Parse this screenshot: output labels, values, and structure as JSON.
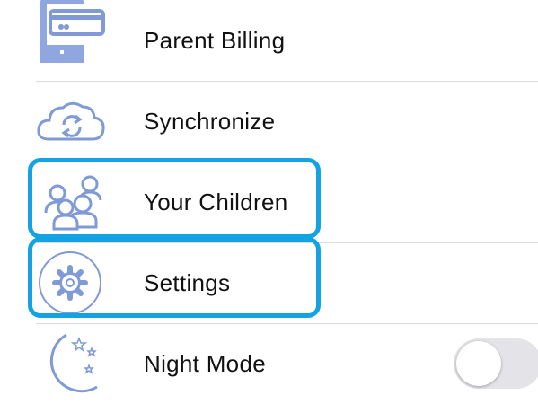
{
  "accent_color": "#13a3e3",
  "icon_color": "#7f9ad6",
  "menu": {
    "items": [
      {
        "label": "Parent Billing",
        "icon": "billing-tablet-icon"
      },
      {
        "label": "Synchronize",
        "icon": "sync-cloud-icon"
      },
      {
        "label": "Your Children",
        "icon": "children-icon",
        "highlighted": true
      },
      {
        "label": "Settings",
        "icon": "gear-icon",
        "highlighted": true
      },
      {
        "label": "Night Mode",
        "icon": "moon-stars-icon",
        "toggle": false
      }
    ]
  }
}
